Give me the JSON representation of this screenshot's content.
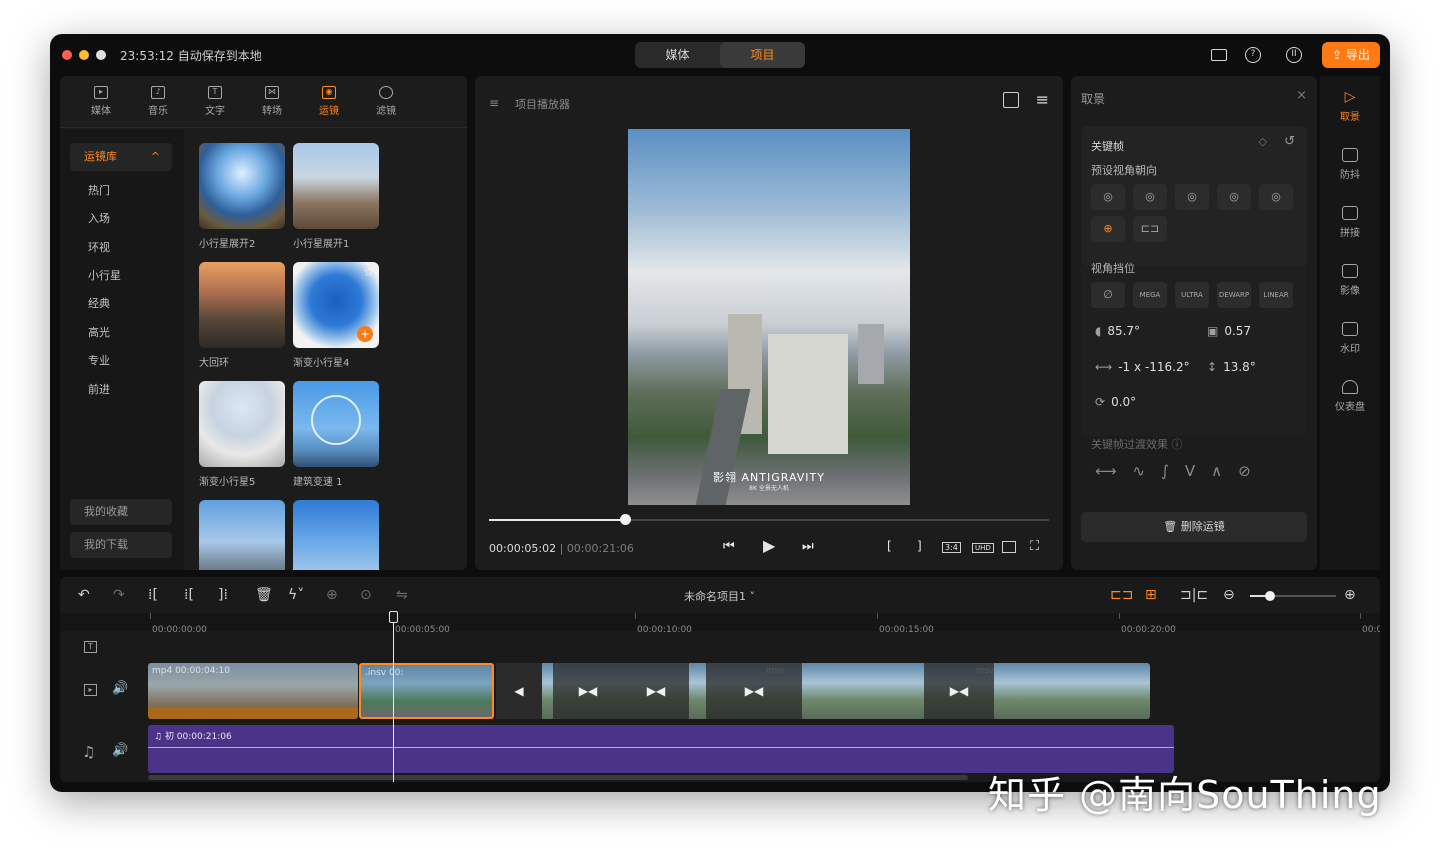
{
  "titlebar": {
    "save_status": "23:53:12 自动保存到本地",
    "seg_tabs": [
      "媒体",
      "项目"
    ],
    "active_seg": "项目",
    "export_label": "导出",
    "accent": "#ff7a12"
  },
  "library": {
    "tabs": [
      {
        "label": "媒体",
        "icon": "media-icon"
      },
      {
        "label": "音乐",
        "icon": "music-icon"
      },
      {
        "label": "文字",
        "icon": "text-icon"
      },
      {
        "label": "转场",
        "icon": "transition-icon"
      },
      {
        "label": "运镜",
        "icon": "camera-move-icon"
      },
      {
        "label": "滤镜",
        "icon": "filter-icon"
      }
    ],
    "category_header": "运镜库",
    "categories": [
      "热门",
      "入场",
      "环视",
      "小行星",
      "经典",
      "高光",
      "专业",
      "前进"
    ],
    "favorites": "我的收藏",
    "downloads": "我的下载",
    "items": [
      "小行星展开2",
      "小行星展开1",
      "大回环",
      "渐变小行星4",
      "渐变小行星5",
      "建筑变速 1"
    ]
  },
  "preview": {
    "title": "项目播放器",
    "video_watermark": "影翎 ANTIGRAVITY",
    "video_sub": "8K 全景无人机",
    "current_time": "00:00:05:02",
    "duration": "00:00:21:06",
    "progress": 0.24
  },
  "properties": {
    "header": "取景",
    "keyframe_label": "关键帧",
    "preset_label": "预设视角朝向",
    "fov_label": "视角挡位",
    "fov_modes": [
      "MEGA",
      "ULTRA",
      "DEWARP",
      "LINEAR"
    ],
    "fov_value": "85.7°",
    "distortion_value": "0.57",
    "pan_value": "-1 x -116.2°",
    "tilt_value": "13.8°",
    "roll_value": "0.0°",
    "transition_label": "关键帧过渡效果",
    "delete_label": "删除运镜"
  },
  "rail": {
    "items": [
      "取景",
      "防抖",
      "拼接",
      "影像",
      "水印",
      "仪表盘"
    ]
  },
  "timeline": {
    "project_name": "未命名项目1",
    "ruler": [
      "00:00:00:00",
      "00:00:05:00",
      "00:00:10:00",
      "00:00:15:00",
      "00:00:20:00",
      "00:0"
    ],
    "clip1_label": "mp4  00:00:04:10",
    "clip2_label": ".insv  00:",
    "clip3_label": "insv",
    "clip4_label": "insv",
    "audio_label": "初  00:00:21:06"
  },
  "watermark": "知乎 @南向SouThing"
}
